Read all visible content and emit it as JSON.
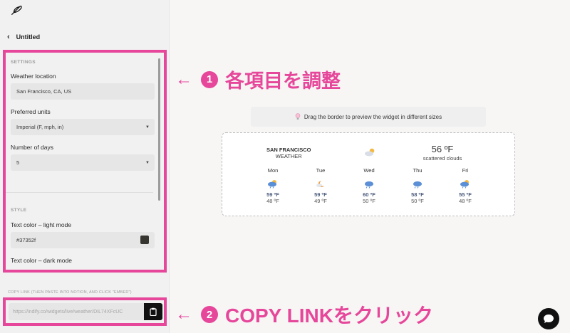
{
  "sidebar": {
    "logo_icon": "feather-icon",
    "back_title": "Untitled",
    "settings_section": "SETTINGS",
    "weather_location_label": "Weather location",
    "weather_location_value": "San Francisco, CA, US",
    "units_label": "Preferred units",
    "units_value": "Imperial (F, mph, in)",
    "days_label": "Number of days",
    "days_value": "5",
    "style_section": "STYLE",
    "text_color_light_label": "Text color – light mode",
    "text_color_light_value": "#37352f",
    "text_color_dark_label": "Text color – dark mode",
    "copy_link_label": "COPY LINK (THEN PASTE INTO NOTION, AND CLICK \"EMBED\")",
    "copy_link_value": "https://indify.co/widgets/live/weather/DIL74XFcUC"
  },
  "annotations": {
    "step1_arrow": "←",
    "step1_num": "1",
    "step1_text": "各項目を調整",
    "step2_arrow": "←",
    "step2_num": "2",
    "step2_text": "COPY LINKをクリック",
    "color": "#e6479a"
  },
  "preview": {
    "tip_icon": "lightbulb-icon",
    "tip_text": "Drag the border to preview the widget in different sizes",
    "widget": {
      "city": "SAN FRANCISCO",
      "city_sub": "WEATHER",
      "current_icon": "partly-cloudy-day-icon",
      "current_temp": "56 ºF",
      "current_desc": "scattered clouds",
      "days": [
        {
          "name": "Mon",
          "icon": "cloudy-rain-icon",
          "hi": "59 ºF",
          "lo": "48 ºF"
        },
        {
          "name": "Tue",
          "icon": "moon-cloud-icon",
          "hi": "59 ºF",
          "lo": "49 ºF"
        },
        {
          "name": "Wed",
          "icon": "cloudy-rain-icon",
          "hi": "60 ºF",
          "lo": "50 ºF"
        },
        {
          "name": "Thu",
          "icon": "cloudy-rain-icon",
          "hi": "58 ºF",
          "lo": "50 ºF"
        },
        {
          "name": "Fri",
          "icon": "cloudy-rain-icon",
          "hi": "55 ºF",
          "lo": "48 ºF"
        }
      ]
    }
  },
  "chat_icon": "chat-bubble-icon"
}
